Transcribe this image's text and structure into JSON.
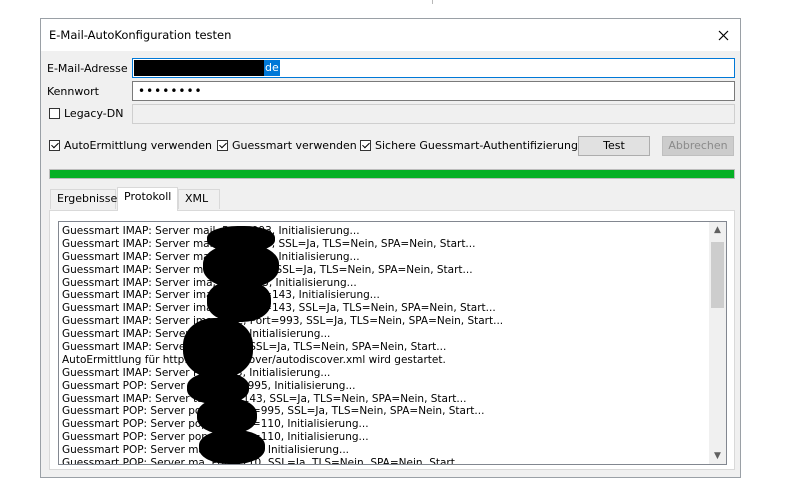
{
  "window": {
    "title": "E-Mail-AutoKonfiguration testen",
    "close_icon": "close-icon"
  },
  "fields": {
    "email": {
      "label": "E-Mail-Adresse",
      "visible_suffix": "de"
    },
    "password": {
      "label": "Kennwort",
      "value": "••••••••"
    },
    "legacy": {
      "label": "Legacy-DN",
      "checked": false
    }
  },
  "options": {
    "autodiscover": {
      "label": "AutoErmittlung verwenden",
      "checked": true
    },
    "guessmart": {
      "label": "Guessmart verwenden",
      "checked": true
    },
    "secure_guessmart": {
      "label": "Sichere Guessmart-Authentifizierung",
      "checked": true
    }
  },
  "buttons": {
    "test": "Test",
    "cancel": "Abbrechen"
  },
  "progress": {
    "fraction": 1.0,
    "color": "#06b025"
  },
  "tabs": [
    {
      "label": "Ergebnisse",
      "active": false
    },
    {
      "label": "Protokoll",
      "active": true
    },
    {
      "label": "XML",
      "active": false
    }
  ],
  "log": [
    "Guessmart IMAP: Server mail, Port=993, Initialisierung...",
    "Guessmart IMAP: Server mail, Port=993, SSL=Ja, TLS=Nein, SPA=Nein, Start...",
    "Guessmart IMAP: Server mail, Port=143, Initialisierung...",
    "Guessmart IMAP: Server mai, Port=143, SSL=Ja, TLS=Nein, SPA=Nein, Start...",
    "Guessmart IMAP: Server ima, Port=993, Initialisierung...",
    "Guessmart IMAP: Server imap.de, Port=143, Initialisierung...",
    "Guessmart IMAP: Server imap.de, Port=143, SSL=Ja, TLS=Nein, SPA=Nein, Start...",
    "Guessmart IMAP: Server imap.t.de, Port=993, SSL=Ja, TLS=Nein, SPA=Nein, Start...",
    "Guessmart IMAP: Server Port=993, Initialisierung...",
    "Guessmart IMAP: Server Port=993, SSL=Ja, TLS=Nein, SPA=Nein, Start...",
    "AutoErmittlung für http.de/autodiscover/autodiscover.xml wird gestartet.",
    "Guessmart IMAP: Server Port=143, Initialisierung...",
    "Guessmart POP: Server p.de, Port=995, Initialisierung...",
    "Guessmart IMAP: Server tal, Port=143, SSL=Ja, TLS=Nein, SPA=Nein, Start...",
    "Guessmart POP: Server pop.de, Port=995, SSL=Ja, TLS=Nein, SPA=Nein, Start...",
    "Guessmart POP: Server pop.de, Port=110, Initialisierung...",
    "Guessmart POP: Server pop.de, Port=110, Initialisierung...",
    "Guessmart POP: Server ma, Port=995, Initialisierung...",
    "Guessmart POP: Server ma, Port=110, SSL=Ja, TLS=Nein, SPA=Nein, Start..."
  ],
  "scrollbar": {
    "up_icon": "chevron-up-icon",
    "down_icon": "chevron-down-icon"
  }
}
